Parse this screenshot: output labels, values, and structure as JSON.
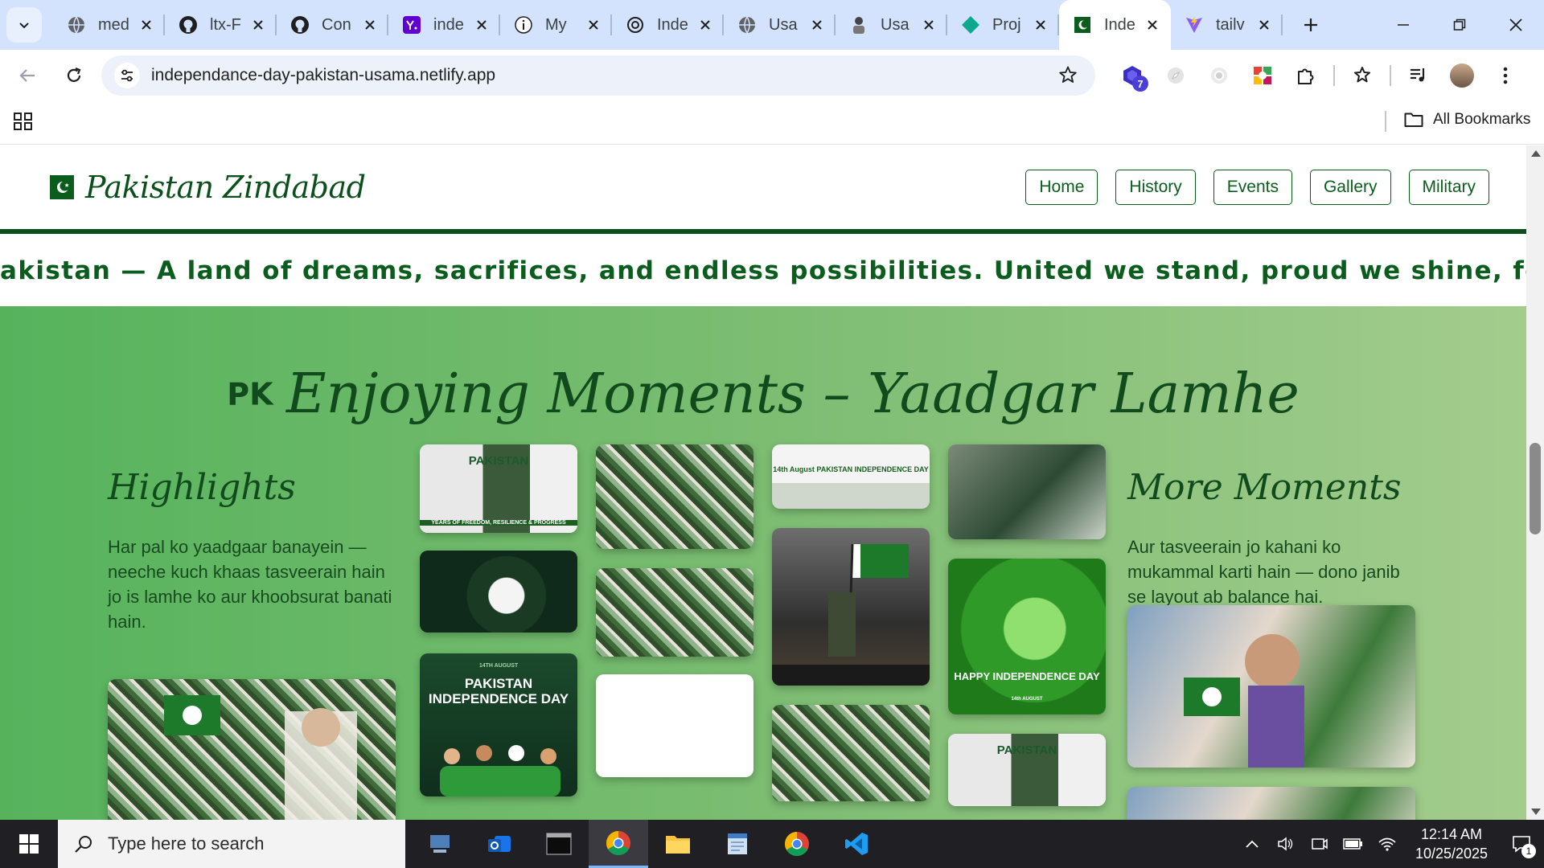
{
  "browser": {
    "tabs": [
      {
        "title": "med",
        "favicon": "globe-icon",
        "active": false
      },
      {
        "title": "ltx-F",
        "favicon": "github-icon",
        "active": false
      },
      {
        "title": "Con",
        "favicon": "github-icon",
        "active": false
      },
      {
        "title": "inde",
        "favicon": "yahoo-icon",
        "active": false
      },
      {
        "title": "My",
        "favicon": "info-icon",
        "active": false
      },
      {
        "title": "Inde",
        "favicon": "openai-icon",
        "active": false
      },
      {
        "title": "Usa",
        "favicon": "globe-icon",
        "active": false
      },
      {
        "title": "Usa",
        "favicon": "person-icon",
        "active": false
      },
      {
        "title": "Proj",
        "favicon": "diamond-icon",
        "active": false
      },
      {
        "title": "Inde",
        "favicon": "pakistan-flag-icon",
        "active": true
      },
      {
        "title": "tailv",
        "favicon": "vite-icon",
        "active": false
      }
    ],
    "url": "independance-day-pakistan-usama.netlify.app",
    "extension_badge": "7",
    "bookmarks_folder": "All Bookmarks"
  },
  "site": {
    "brand": "Pakistan Zindabad",
    "nav": [
      "Home",
      "History",
      "Events",
      "Gallery",
      "Military"
    ],
    "marquee": "akistan — A land of dreams, sacrifices, and endless possibilities. United we stand, proud we shine, forever free and s",
    "moments": {
      "title_prefix": "PK",
      "title": "Enjoying Moments – Yaadgar Lamhe",
      "left_heading": "Highlights",
      "left_text": "Har pal ko yaadgaar banayein — neeche kuch khaas tasveerain hain jo is lamhe ko aur khoobsurat banati hain.",
      "right_heading": "More Moments",
      "right_text": "Aur tasveerain jo kahani ko mukammal karti hain — dono janib se layout ab balance hai.",
      "photo_captions": {
        "p1": "PAKISTAN",
        "p1_sub": "YEARS OF FREEDOM, RESILIENCE & PROGRESS",
        "p7": "14th August PAKISTAN INDEPENDENCE DAY",
        "p9": "PAKISTAN INDEPENDENCE DAY",
        "p10": "14TH AUGUST",
        "p11": "HAPPY INDEPENDENCE DAY",
        "p12": "14th AUGUST",
        "p13": "PAKISTAN"
      }
    }
  },
  "taskbar": {
    "search_placeholder": "Type here to search",
    "time": "12:14 AM",
    "date": "10/25/2025",
    "notifications": "1"
  },
  "colors": {
    "brand_green": "#0b5d1e",
    "dark_green": "#114b1d",
    "tabstrip": "#d3e3fd",
    "omnibox": "#edf2fa",
    "taskbar": "#1f1f24"
  }
}
